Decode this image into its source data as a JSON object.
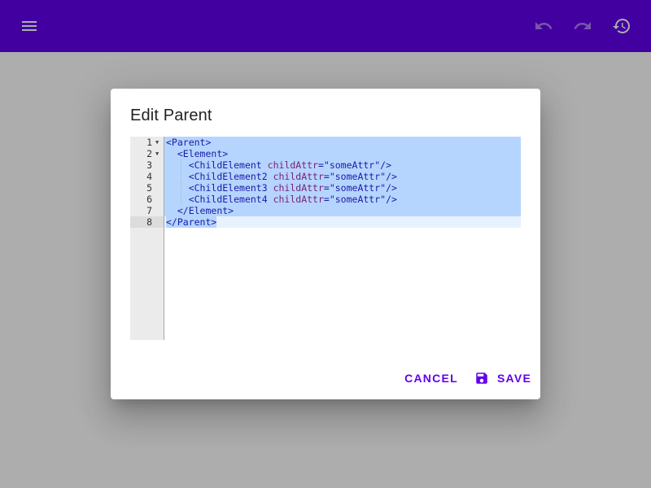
{
  "appbar": {
    "background": "#6200ee",
    "icons": {
      "menu": "menu-icon",
      "undo": "undo-icon",
      "redo": "redo-icon",
      "history": "history-icon"
    }
  },
  "dialog": {
    "title": "Edit Parent",
    "cancel_label": "CANCEL",
    "save_label": "SAVE",
    "save_icon": "save-icon"
  },
  "editor": {
    "line_numbers": [
      "1",
      "2",
      "3",
      "4",
      "5",
      "6",
      "7",
      "8"
    ],
    "foldable_lines": [
      1,
      2
    ],
    "active_line": 8,
    "selection": "all",
    "lines": [
      "<Parent>",
      "  <Element>",
      "    <ChildElement childAttr=\"someAttr\"/>",
      "    <ChildElement2 childAttr=\"someAttr\"/>",
      "    <ChildElement3 childAttr=\"someAttr\"/>",
      "    <ChildElement4 childAttr=\"someAttr\"/>",
      "  </Element>",
      "</Parent>"
    ]
  },
  "colors": {
    "accent": "#6200ee",
    "selection": "#b5d5ff",
    "gutter": "#ebebeb"
  }
}
